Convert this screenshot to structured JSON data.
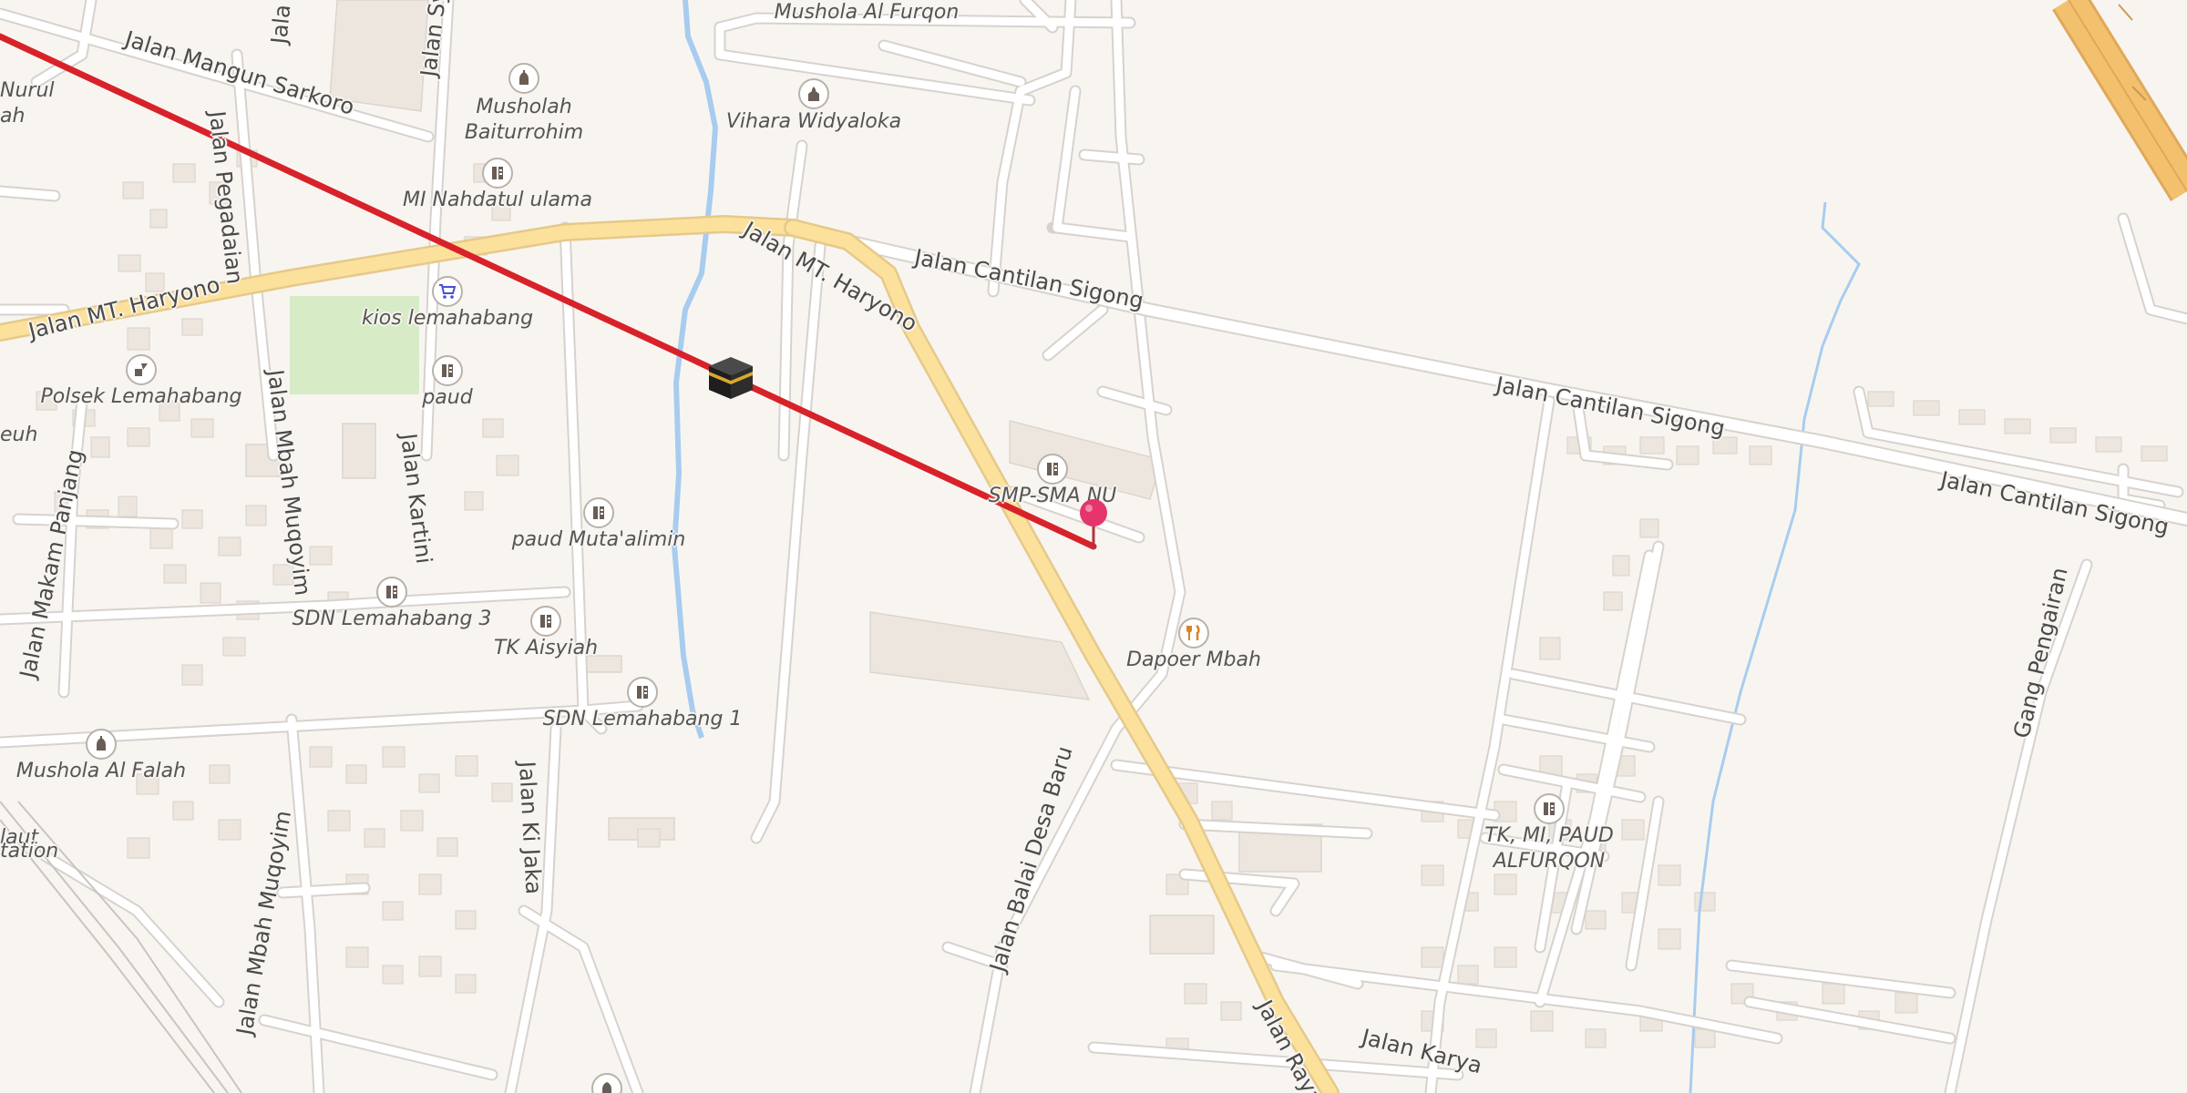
{
  "map": {
    "colors": {
      "background": "#f8f5f1",
      "road": "#ffffff",
      "road_casing": "#d7d2cc",
      "main_road": "#fbe19b",
      "main_road_casing": "#e6c98a",
      "highway": "#f3c16e",
      "water": "#a8ccef",
      "building": "#ece6df",
      "park": "#d6ebc6",
      "route_line": "#d8222a",
      "pin": "#e5356b"
    },
    "roads": [
      {
        "name": "Jalan Mangun Sarkoro"
      },
      {
        "name": "Jalan MT. Haryono"
      },
      {
        "name": "Jalan MT. Haryono"
      },
      {
        "name": "Jalan Pegadaian"
      },
      {
        "name": "Jalan Mbah Muqoyim"
      },
      {
        "name": "Jalan Kartini"
      },
      {
        "name": "Jalan Makam Panjang"
      },
      {
        "name": "Jalan Cantilan Sigong"
      },
      {
        "name": "Jalan Cantilan Sigong"
      },
      {
        "name": "Jalan Cantilan Sigong"
      },
      {
        "name": "Jalan Ki Jaka"
      },
      {
        "name": "Jalan Mbah Muqoyim"
      },
      {
        "name": "Jalan Balai Desa Baru"
      },
      {
        "name": "Jalan Raya"
      },
      {
        "name": "Jalan Karya"
      },
      {
        "name": "Gang Pengairan"
      },
      {
        "name": "Jalan Sy"
      },
      {
        "name": "Jala"
      }
    ],
    "places": [
      {
        "name": "Mushola Al Furqon",
        "icon": ""
      },
      {
        "name": "Vihara Widyaloka",
        "icon": "place-of-worship-icon"
      },
      {
        "name": "Musholah Baiturrohim",
        "icon": "mosque-icon"
      },
      {
        "name": "MI Nahdatul ulama",
        "icon": "school-icon"
      },
      {
        "name": "kios lemahabang",
        "icon": "shopping-cart-icon"
      },
      {
        "name": "Polsek Lemahabang",
        "icon": "police-icon"
      },
      {
        "name": "paud",
        "icon": "school-icon"
      },
      {
        "name": "paud Muta'alimin",
        "icon": "school-icon"
      },
      {
        "name": "SMP-SMA NU",
        "icon": "school-icon"
      },
      {
        "name": "SDN Lemahabang 3",
        "icon": "school-icon"
      },
      {
        "name": "TK Aisyiah",
        "icon": "school-icon"
      },
      {
        "name": "SDN Lemahabang 1",
        "icon": "school-icon"
      },
      {
        "name": "Dapoer Mbah",
        "icon": "restaurant-icon"
      },
      {
        "name": "Mushola Al Falah",
        "icon": "mosque-icon"
      },
      {
        "name": "TK, MI, PAUD ALFURQON",
        "icon": "school-icon"
      },
      {
        "name": "Nurul",
        "icon": ""
      },
      {
        "name": "ah",
        "icon": ""
      },
      {
        "name": "euh",
        "icon": ""
      },
      {
        "name": "laut",
        "icon": ""
      },
      {
        "name": "tation",
        "icon": ""
      }
    ],
    "markers": {
      "kaaba": {
        "icon": "kaaba-icon"
      },
      "location_pin": {
        "icon": "location-pin-icon"
      },
      "route_line": {
        "meaning": "qibla-direction-line"
      }
    }
  }
}
